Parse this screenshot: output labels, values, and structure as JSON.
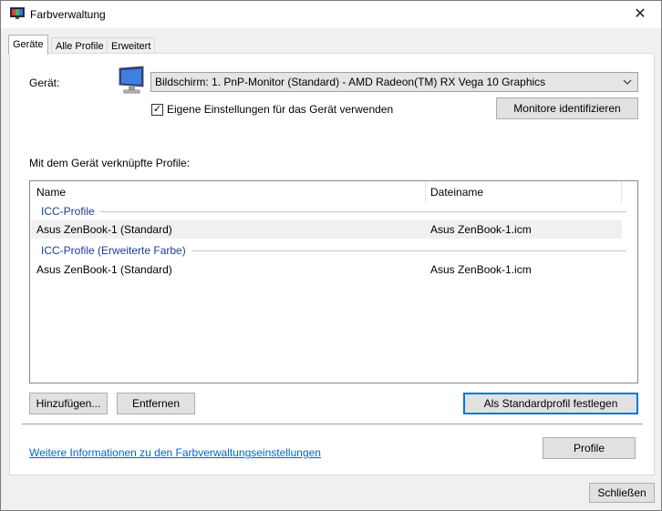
{
  "window": {
    "title": "Farbverwaltung",
    "close_glyph": "✕",
    "icon": "color-management-icon"
  },
  "tabs": [
    {
      "label": "Geräte",
      "active": true
    },
    {
      "label": "Alle Profile",
      "active": false
    },
    {
      "label": "Erweitert",
      "active": false
    }
  ],
  "device": {
    "label": "Gerät:",
    "selected": "Bildschirm: 1. PnP-Monitor (Standard) - AMD Radeon(TM) RX Vega 10 Graphics",
    "icon": "monitor-icon",
    "own_settings_label": "Eigene Einstellungen für das Gerät verwenden",
    "own_settings_checked": true,
    "check_glyph": "✓",
    "identify_button": "Monitore identifizieren"
  },
  "profiles": {
    "label": "Mit dem Gerät verknüpfte Profile:",
    "columns": [
      "Name",
      "Dateiname"
    ],
    "groups": [
      {
        "title": "ICC-Profile",
        "rows": [
          {
            "name": "Asus ZenBook-1 (Standard)",
            "file": "Asus ZenBook-1.icm",
            "selected": true
          }
        ]
      },
      {
        "title": "ICC-Profile (Erweiterte Farbe)",
        "rows": [
          {
            "name": "Asus ZenBook-1 (Standard)",
            "file": "Asus ZenBook-1.icm",
            "selected": false
          }
        ]
      }
    ]
  },
  "actions": {
    "add": "Hinzufügen...",
    "remove": "Entfernen",
    "set_default": "Als Standardprofil festlegen"
  },
  "footer": {
    "info_link": "Weitere Informationen zu den Farbverwaltungseinstellungen",
    "profiles_button": "Profile",
    "close_button": "Schließen"
  },
  "colors": {
    "accent": "#0078d7",
    "group_header": "#1e3d8c",
    "link": "#0066cc"
  }
}
